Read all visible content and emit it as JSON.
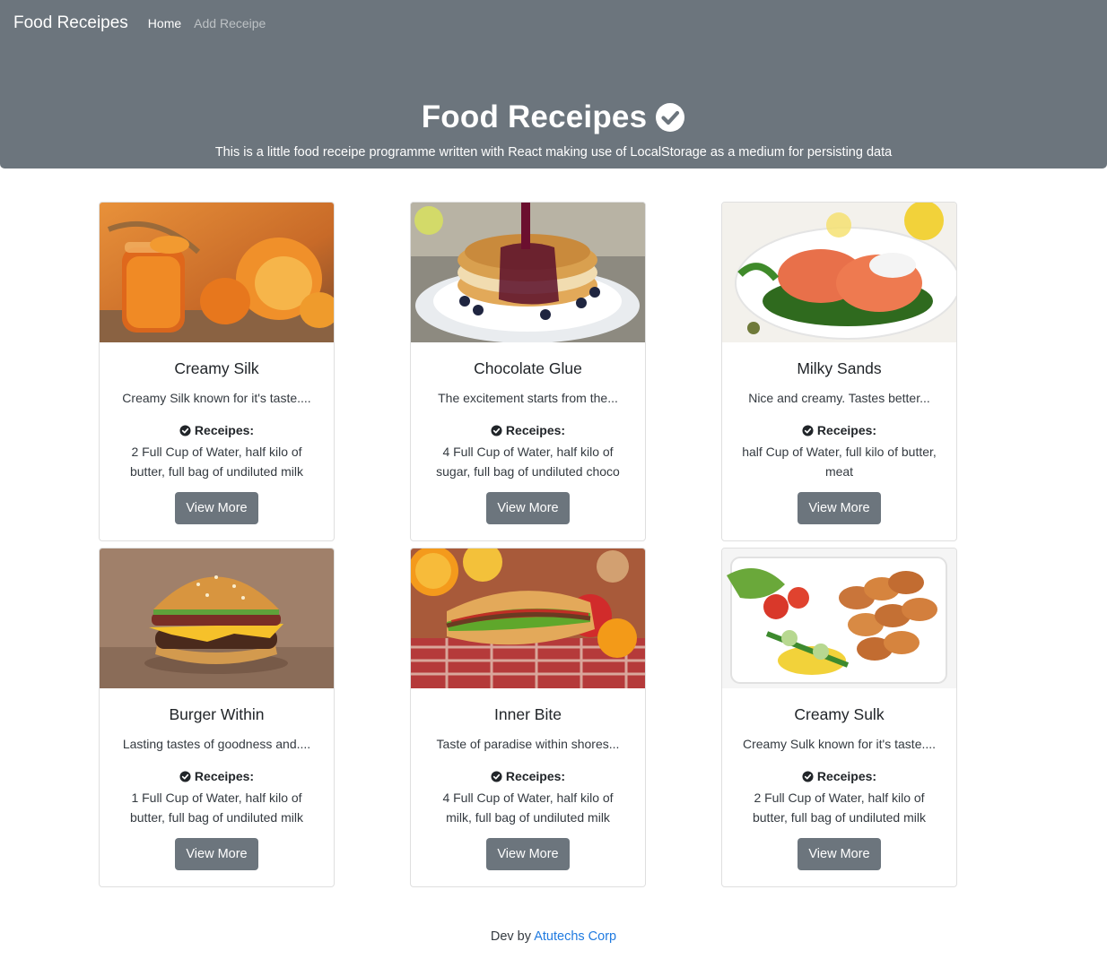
{
  "navbar": {
    "brand": "Food Receipes",
    "links": [
      {
        "label": "Home",
        "active": true
      },
      {
        "label": "Add Receipe",
        "active": false
      }
    ]
  },
  "hero": {
    "title": "Food Receipes",
    "subtitle": "This is a little food receipe programme written with React making use of LocalStorage as a medium for persisting data",
    "icon": "check-circle-icon"
  },
  "cards": [
    {
      "title": "Creamy Silk",
      "description": "Creamy Silk known for it's taste....",
      "recipe_label": "Receipes:",
      "ingredients": "2 Full Cup of Water, half kilo of butter, full bag of undiluted milk",
      "button": "View More",
      "image": "jam-and-oranges-photo"
    },
    {
      "title": "Chocolate Glue",
      "description": "The excitement starts from the...",
      "recipe_label": "Receipes:",
      "ingredients": "4 Full Cup of Water, half kilo of sugar, full bag of undiluted choco",
      "button": "View More",
      "image": "pancakes-with-syrup-photo"
    },
    {
      "title": "Milky Sands",
      "description": "Nice and creamy. Tastes better...",
      "recipe_label": "Receipes:",
      "ingredients": "half Cup of Water, full kilo of butter, meat",
      "button": "View More",
      "image": "salmon-fillets-photo"
    },
    {
      "title": "Burger Within",
      "description": "Lasting tastes of goodness and....",
      "recipe_label": "Receipes:",
      "ingredients": "1 Full Cup of Water, half kilo of butter, full bag of undiluted milk",
      "button": "View More",
      "image": "cheeseburger-photo"
    },
    {
      "title": "Inner Bite",
      "description": "Taste of paradise within shores...",
      "recipe_label": "Receipes:",
      "ingredients": "4 Full Cup of Water, half kilo of milk, full bag of undiluted milk",
      "button": "View More",
      "image": "sandwich-and-fruit-photo"
    },
    {
      "title": "Creamy Sulk",
      "description": "Creamy Sulk known for it's taste....",
      "recipe_label": "Receipes:",
      "ingredients": "2 Full Cup of Water, half kilo of butter, full bag of undiluted milk",
      "button": "View More",
      "image": "chicken-skewers-photo"
    }
  ],
  "footer": {
    "prefix": "Dev by",
    "link": "Atutechs Corp",
    "link_color": "#1f7ae0"
  },
  "colors": {
    "nav_bg": "#6c757d",
    "button_bg": "#6c757d"
  }
}
